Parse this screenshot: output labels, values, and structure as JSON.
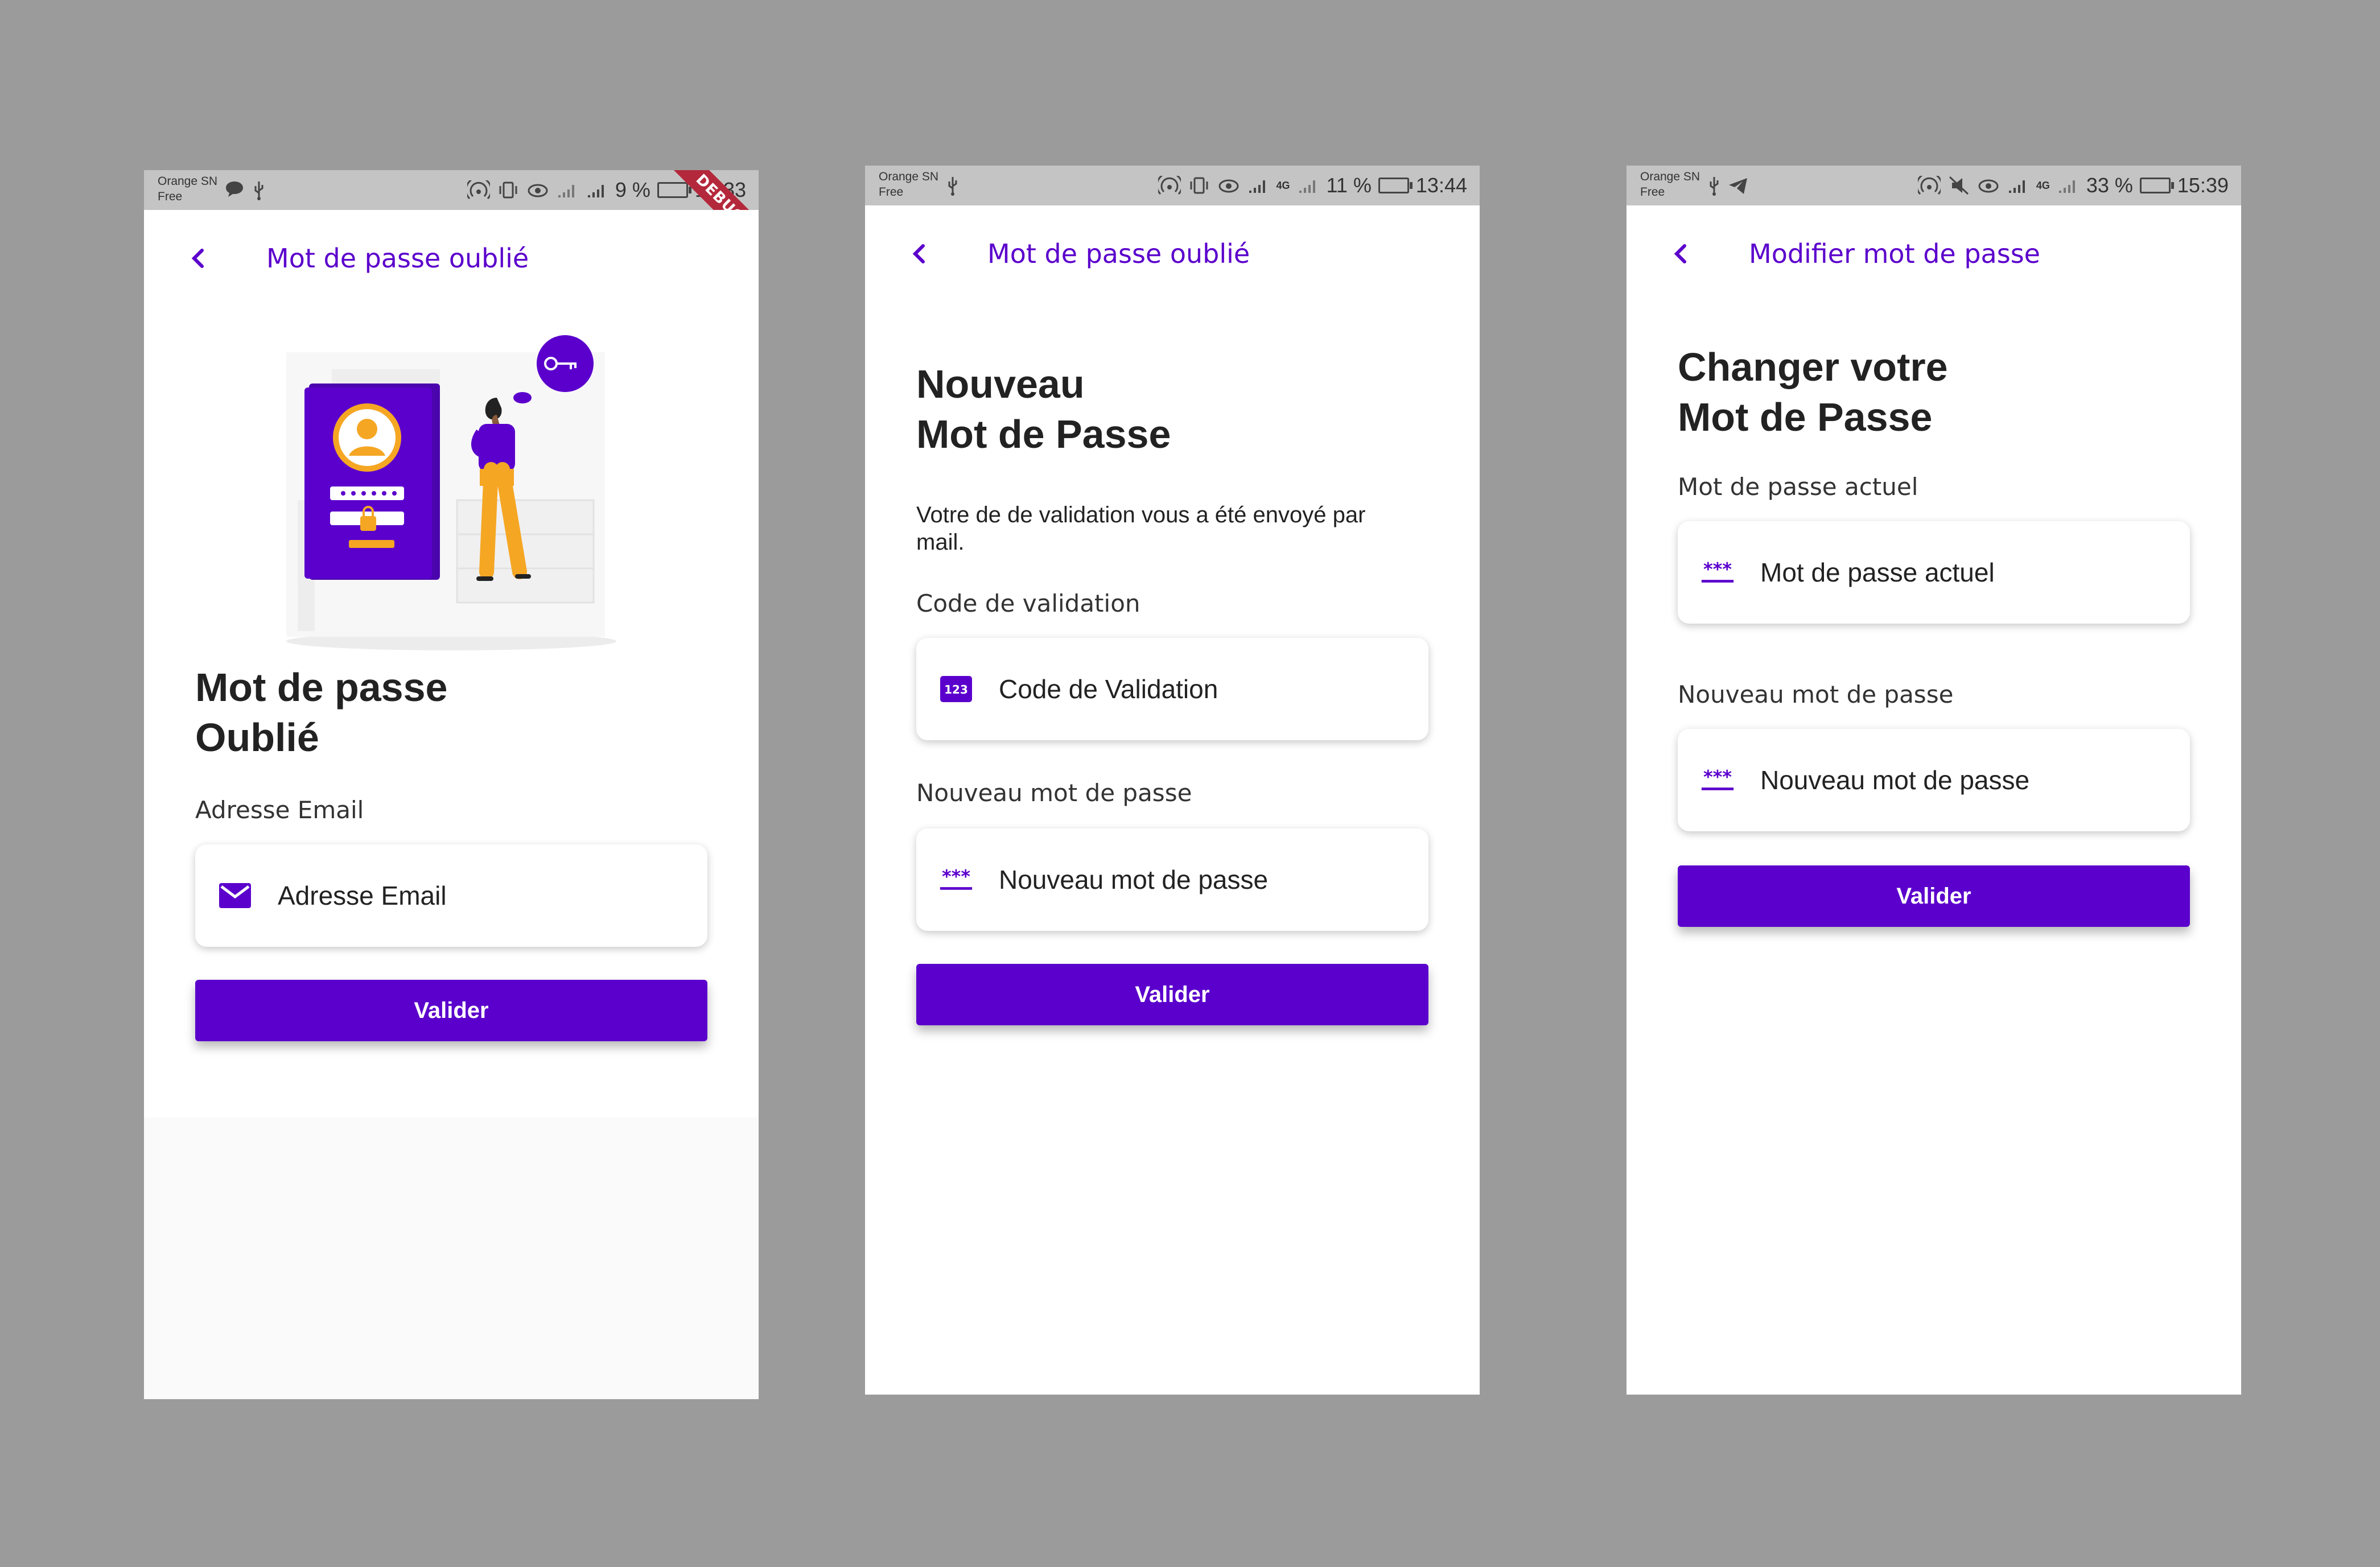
{
  "colors": {
    "accent": "#5b00cc",
    "background": "#9b9b9b",
    "illustration_orange": "#f5a623"
  },
  "screens": [
    {
      "status": {
        "carrier_line1": "Orange SN",
        "carrier_line2": "Free",
        "battery": "9 %",
        "time": "12:33"
      },
      "debug_label": "DEBUG",
      "appbar": {
        "title": "Mot de passe oublié",
        "back_icon": "chevron-left-icon"
      },
      "heading_line1": "Mot de passe",
      "heading_line2": "Oublié",
      "email": {
        "label": "Adresse Email",
        "placeholder": "Adresse Email",
        "icon": "mail-icon"
      },
      "submit_label": "Valider"
    },
    {
      "status": {
        "carrier_line1": "Orange SN",
        "carrier_line2": "Free",
        "network": "4G",
        "battery": "11 %",
        "time": "13:44"
      },
      "appbar": {
        "title": "Mot de passe oublié",
        "back_icon": "chevron-left-icon"
      },
      "heading_line1": "Nouveau",
      "heading_line2": "Mot de Passe",
      "info_text": "Votre de de validation vous a été envoyé par mail.",
      "code": {
        "label": "Code de validation",
        "placeholder": "Code de Validation",
        "icon": "numeric-123-icon",
        "icon_text": "123"
      },
      "new_password": {
        "label": "Nouveau mot de passe",
        "placeholder": "Nouveau mot de passe",
        "icon": "password-icon",
        "icon_text": "***"
      },
      "submit_label": "Valider"
    },
    {
      "status": {
        "carrier_line1": "Orange SN",
        "carrier_line2": "Free",
        "network": "4G",
        "battery": "33 %",
        "time": "15:39"
      },
      "appbar": {
        "title": "Modifier mot de passe",
        "back_icon": "chevron-left-icon"
      },
      "heading_line1": "Changer votre",
      "heading_line2": "Mot de Passe",
      "current_password": {
        "label": "Mot de passe actuel",
        "placeholder": "Mot de passe actuel",
        "icon": "password-icon",
        "icon_text": "***"
      },
      "new_password": {
        "label": "Nouveau mot de passe",
        "placeholder": "Nouveau mot de passe",
        "icon": "password-icon",
        "icon_text": "***"
      },
      "submit_label": "Valider"
    }
  ]
}
